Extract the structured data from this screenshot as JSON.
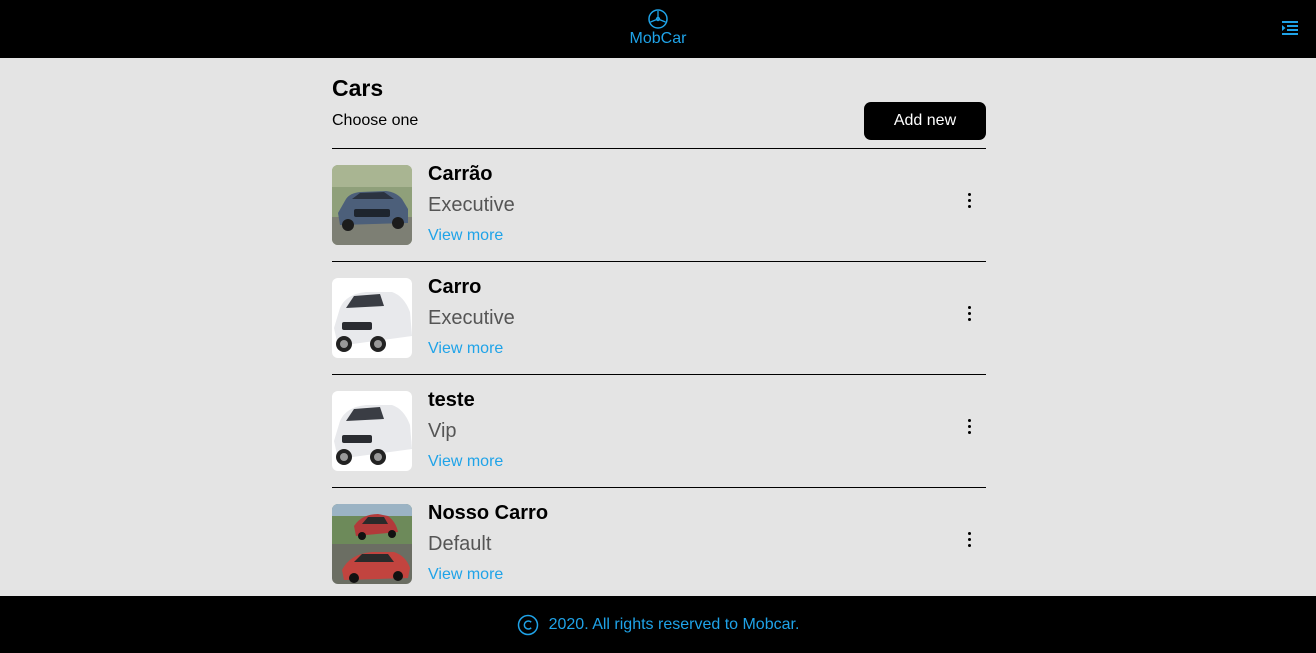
{
  "header": {
    "brand": "MobCar",
    "logo_icon": "steering-wheel-icon",
    "menu_icon": "menu-collapse-icon",
    "accent_color": "#1fa3e8"
  },
  "page": {
    "title": "Cars",
    "subtitle": "Choose one",
    "add_label": "Add new"
  },
  "cars": [
    {
      "name": "Carrão",
      "category": "Executive",
      "link": "View more",
      "image": "gray-sedan"
    },
    {
      "name": "Carro",
      "category": "Executive",
      "link": "View more",
      "image": "white-hatchback"
    },
    {
      "name": "teste",
      "category": "Vip",
      "link": "View more",
      "image": "white-hatchback"
    },
    {
      "name": "Nosso Carro",
      "category": "Default",
      "link": "View more",
      "image": "red-hatchbacks"
    }
  ],
  "footer": {
    "icon": "copyright-icon",
    "text": "2020. All rights reserved to Mobcar."
  }
}
